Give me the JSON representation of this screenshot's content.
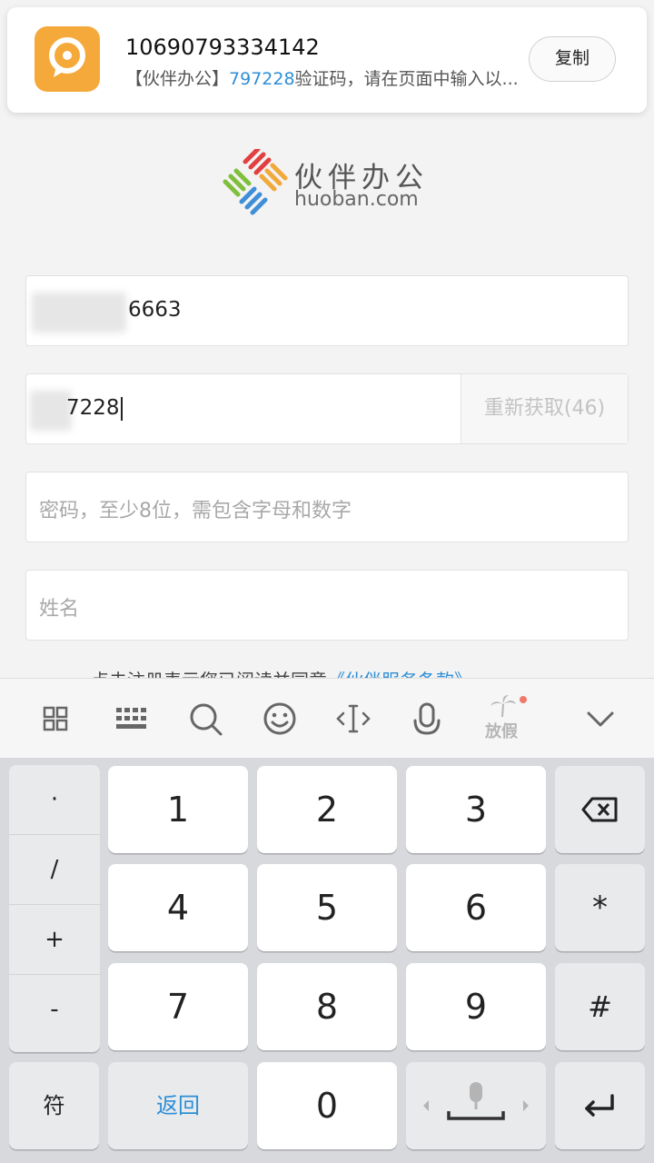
{
  "notification": {
    "sender": "10690793334142",
    "body_prefix": "【伙伴办公】",
    "code": "797228",
    "body_suffix": "验证码，请在页面中输入以...",
    "copy_label": "复制",
    "icon": "message-bubble-icon"
  },
  "logo": {
    "name_cn": "伙伴办公",
    "domain": "huoban.com"
  },
  "form": {
    "phone_value": "6663",
    "code_value": "7228",
    "resend_label": "重新获取(46)",
    "password_placeholder": "密码，至少8位，需包含字母和数字",
    "name_placeholder": "姓名",
    "terms_prefix": "点击注册表示您已阅读并同意",
    "terms_link": "《伙伴服务条款》"
  },
  "keyboard_toolbar": {
    "icons": [
      "grid-icon",
      "keyboard-icon",
      "search-icon",
      "emoji-icon",
      "cursor-icon",
      "microphone-icon",
      "holiday-icon",
      "chevron-down-icon"
    ],
    "holiday_label": "放假"
  },
  "keyboard": {
    "symbols": [
      "·",
      "/",
      "+",
      "-"
    ],
    "digits": [
      "1",
      "2",
      "3",
      "4",
      "5",
      "6",
      "7",
      "8",
      "9",
      "0"
    ],
    "symbol_key": "符",
    "back_key": "返回",
    "star_key": "*",
    "hash_key": "#",
    "colors": {
      "accent": "#2e8fd6"
    }
  }
}
